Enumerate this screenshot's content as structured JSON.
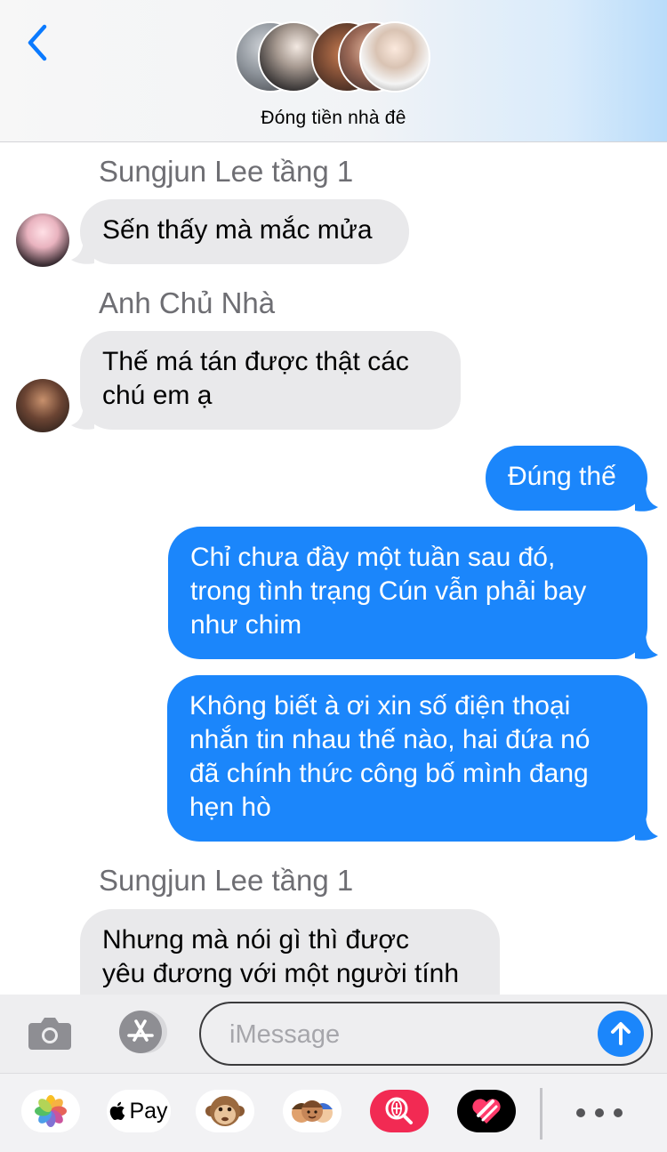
{
  "header": {
    "back_icon": "chevron-left-icon",
    "group_title": "Đóng tiền nhà đê"
  },
  "messages": [
    {
      "type": "sender",
      "name": "Sungjun Lee tầng 1"
    },
    {
      "type": "incoming",
      "lines": [
        "Sến thấy mà mắc mửa"
      ]
    },
    {
      "type": "sender",
      "name": "Anh Chủ Nhà"
    },
    {
      "type": "incoming",
      "lines": [
        "Thế má tán được thật các",
        "chú em ạ"
      ]
    },
    {
      "type": "outgoing",
      "lines": [
        "Đúng thế"
      ]
    },
    {
      "type": "outgoing",
      "lines": [
        "Chỉ chưa đầy một tuần sau đó,",
        "trong tình trạng Cún vẫn phải bay",
        "như chim"
      ]
    },
    {
      "type": "outgoing",
      "lines": [
        "Không biết à ơi xin số điện thoại",
        "nhắn tin nhau thế nào, hai đứa nó",
        "đã chính thức công bố mình đang",
        "hẹn hò"
      ]
    },
    {
      "type": "sender",
      "name": "Sungjun Lee tầng 1"
    },
    {
      "type": "incoming",
      "lines": [
        "Nhưng mà nói gì thì được",
        "yêu đương với một người tính"
      ]
    }
  ],
  "compose": {
    "placeholder": "iMessage",
    "camera_icon": "camera-icon",
    "appstore_icon": "app-store-icon",
    "send_icon": "arrow-up-icon"
  },
  "drawer": {
    "apple_pay_label": "Pay",
    "apps": [
      "photos-icon",
      "apple-pay-icon",
      "monkey-animoji-icon",
      "memoji-icon",
      "image-search-icon",
      "digital-touch-icon"
    ],
    "more_icon": "more-icon"
  },
  "colors": {
    "outgoing_bubble": "#1b86fb",
    "incoming_bubble": "#e9e9eb",
    "sender_name": "#6e6e73",
    "accent": "#0a7aff"
  }
}
